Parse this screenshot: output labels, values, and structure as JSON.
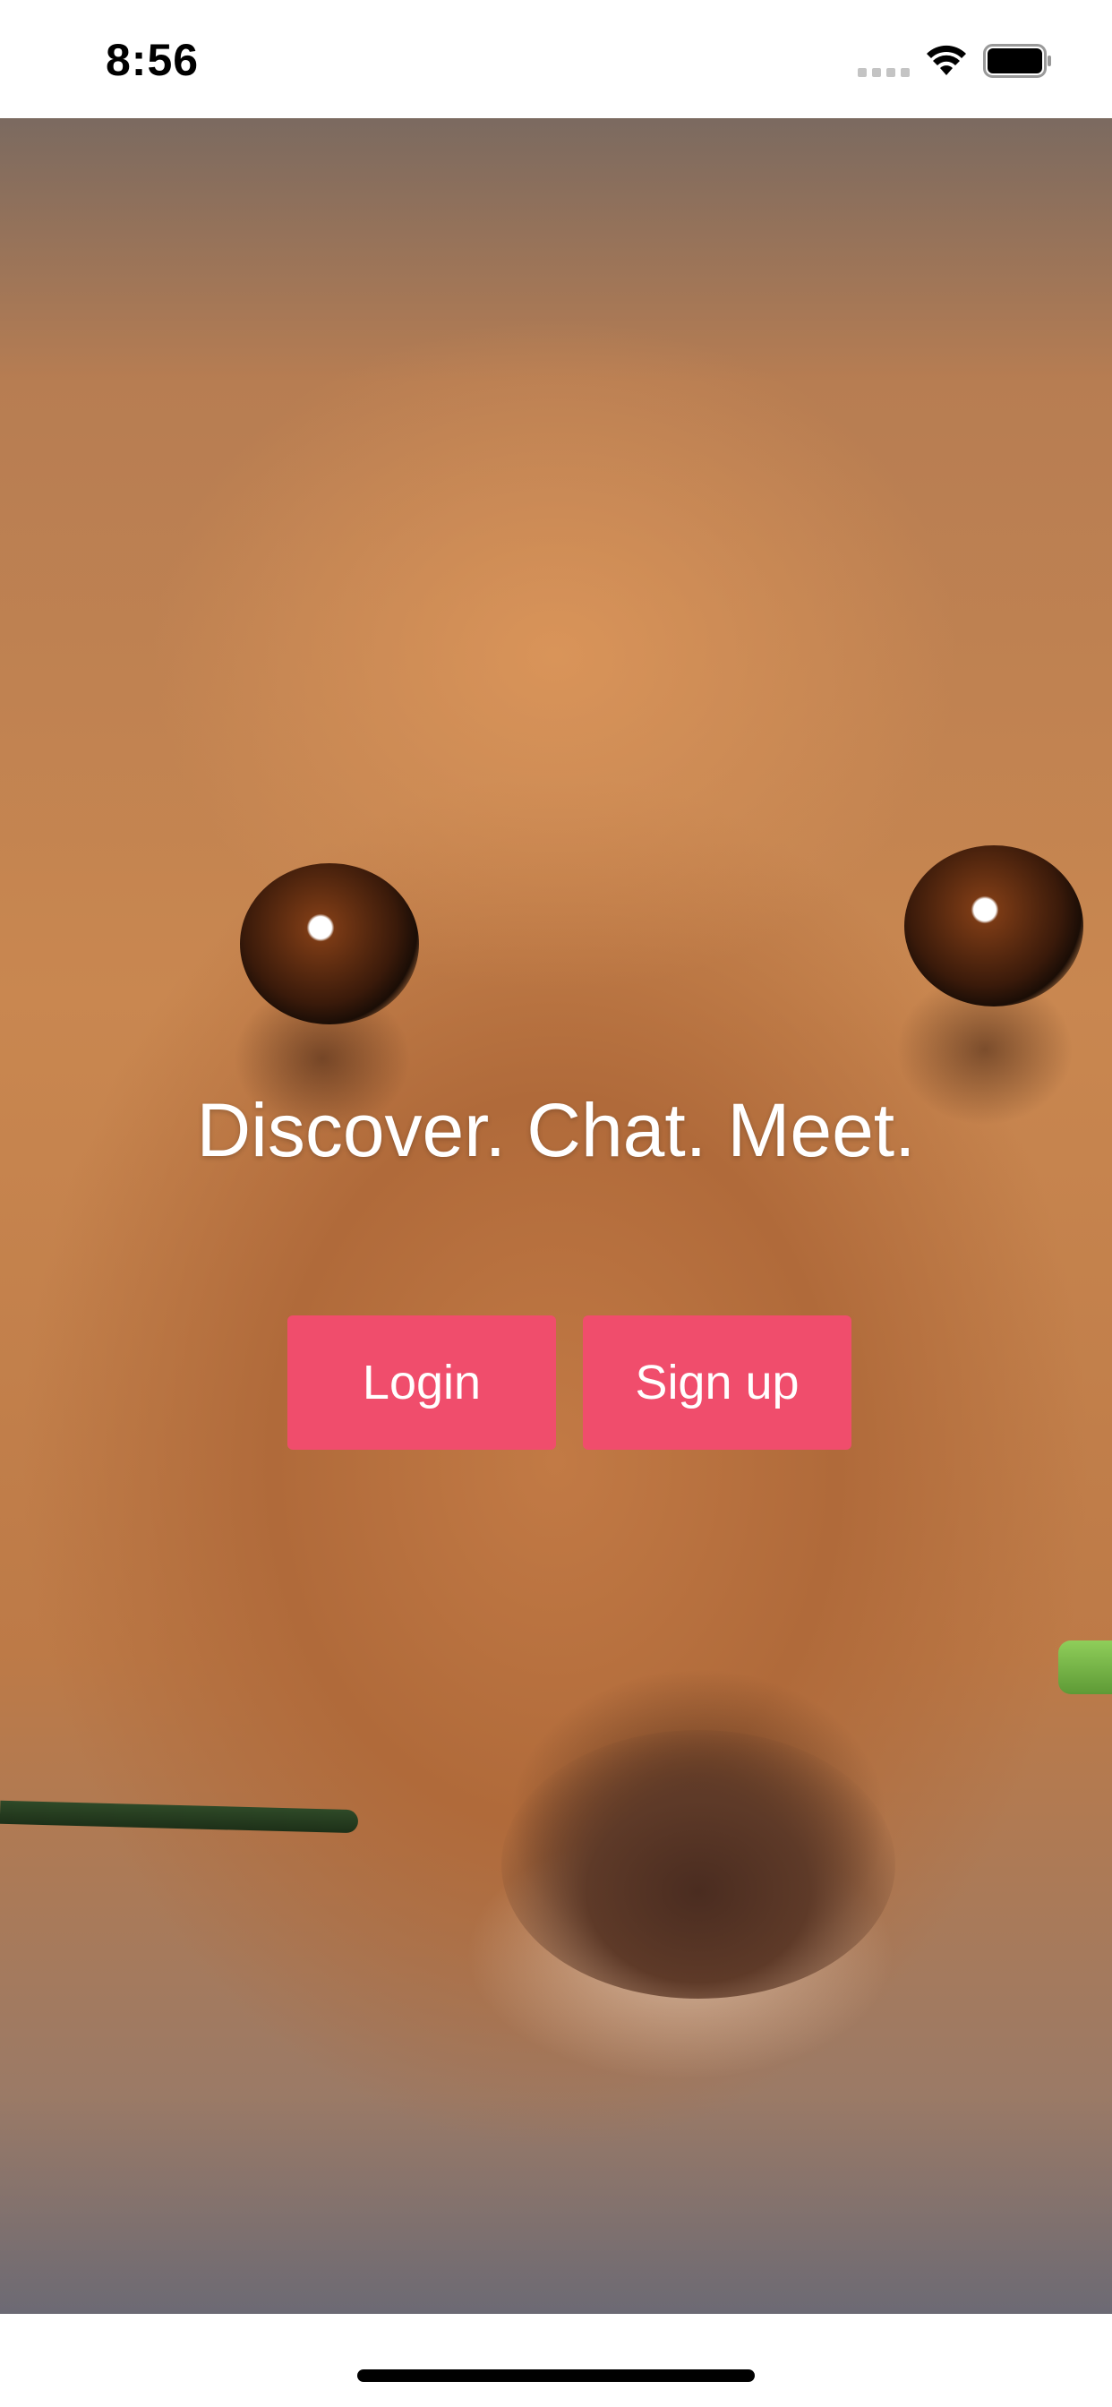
{
  "status_bar": {
    "time": "8:56",
    "icons": [
      "signal-dots-icon",
      "wifi-icon",
      "battery-icon"
    ]
  },
  "hero": {
    "background": "golden-retriever-photo",
    "tagline": "Discover. Chat. Meet."
  },
  "actions": {
    "login_label": "Login",
    "signup_label": "Sign up"
  },
  "colors": {
    "accent": "#f04d6c",
    "text_on_photo": "#ffffff"
  }
}
